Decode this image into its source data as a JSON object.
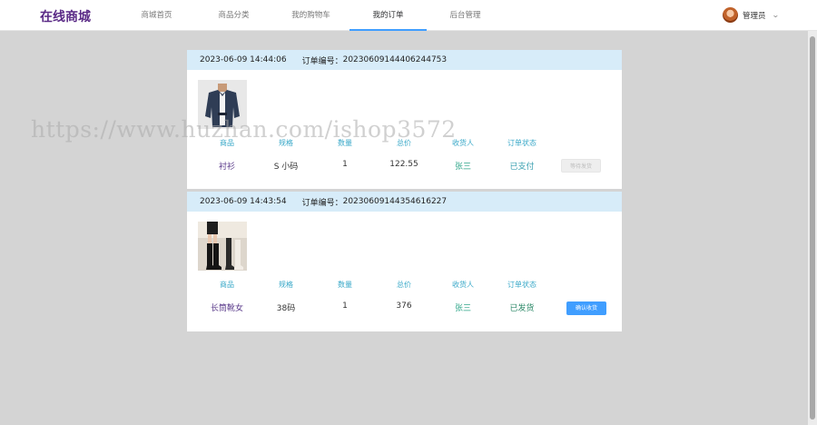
{
  "header": {
    "brand": "在线商城",
    "nav": [
      {
        "label": "商城首页"
      },
      {
        "label": "商品分类"
      },
      {
        "label": "我的购物车"
      },
      {
        "label": "我的订单"
      },
      {
        "label": "后台管理"
      }
    ],
    "active_index": 3,
    "user": {
      "name": "管理员"
    }
  },
  "columns": [
    "商品",
    "规格",
    "数量",
    "总价",
    "收货人",
    "订单状态"
  ],
  "order_number_label": "订单编号：",
  "orders": [
    {
      "time": "2023-06-09 14:44:06",
      "number": "20230609144406244753",
      "image": "jacket-image",
      "product": "衬衫",
      "spec": "S 小码",
      "qty": "1",
      "total": "122.55",
      "receiver": "张三",
      "status": "已支付",
      "action": "等待发货"
    },
    {
      "time": "2023-06-09 14:43:54",
      "number": "20230609144354616227",
      "image": "boots-image",
      "product": "长筒靴女",
      "spec": "38码",
      "qty": "1",
      "total": "376",
      "receiver": "张三",
      "status": "已发货",
      "action": "确认收货"
    }
  ],
  "watermark": "https://www.huzhan.com/ishop3572",
  "colors": {
    "brand": "#5a2a86",
    "accent": "#409eff",
    "header_row": "#d7ecf9",
    "column_label": "#38a8c8"
  }
}
